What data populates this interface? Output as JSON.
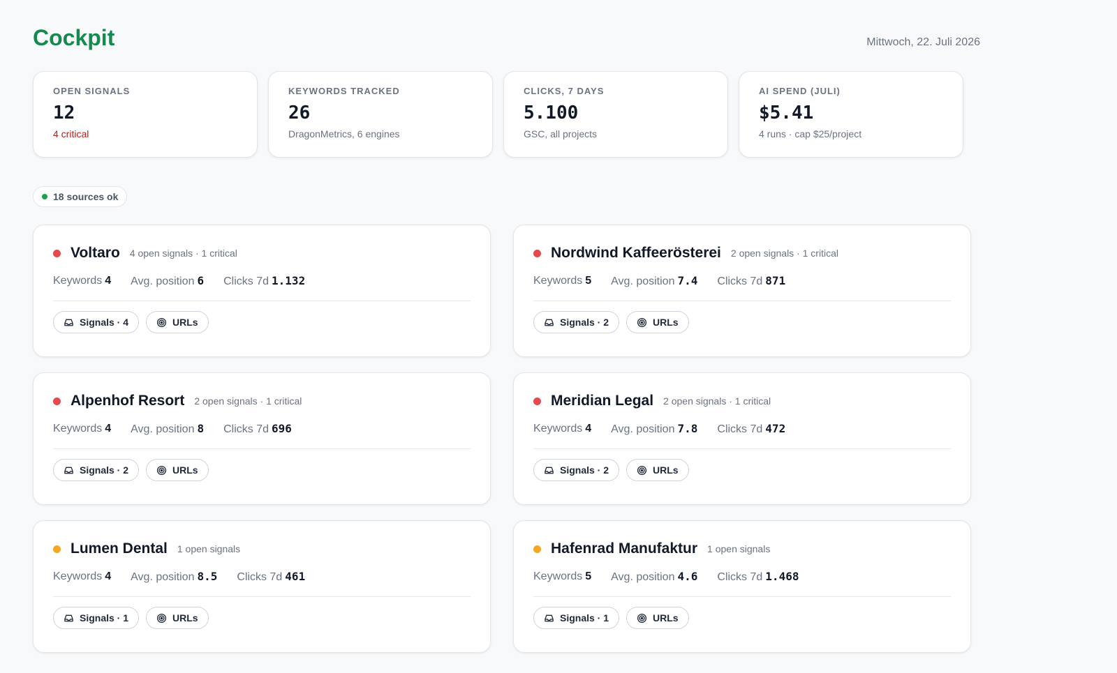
{
  "header": {
    "title": "Cockpit",
    "date": "Mittwoch, 22. Juli 2026"
  },
  "stats": [
    {
      "label": "Open signals",
      "value": "12",
      "sub": "4 critical",
      "sub_critical": true
    },
    {
      "label": "Keywords tracked",
      "value": "26",
      "sub": "DragonMetrics, 6 engines",
      "sub_critical": false
    },
    {
      "label": "Clicks, 7 days",
      "value": "5.100",
      "sub": "GSC, all projects",
      "sub_critical": false
    },
    {
      "label": "AI spend (Juli)",
      "value": "$5.41",
      "sub": "4 runs · cap $25/project",
      "sub_critical": false
    }
  ],
  "health": {
    "label": "18 sources ok",
    "color": "#16a34a"
  },
  "labels": {
    "keywords": "Keywords",
    "avg_position": "Avg. position",
    "clicks": "Clicks 7d",
    "urls": "URLs"
  },
  "colors": {
    "brand": "#15894f",
    "critical": "#e5484d",
    "warning": "#f5a623",
    "ok": "#16a34a"
  },
  "projects": [
    {
      "name": "Voltaro",
      "status": "critical",
      "status_color": "#e5484d",
      "meta": "4 open signals · 1 critical",
      "keywords": "4",
      "avg_position": "6",
      "clicks": "1.132",
      "signals_label": "Signals · 4",
      "icons": [
        "inbox-icon",
        "target-icon"
      ]
    },
    {
      "name": "Nordwind Kaffeerösterei",
      "status": "critical",
      "status_color": "#e5484d",
      "meta": "2 open signals · 1 critical",
      "keywords": "5",
      "avg_position": "7.4",
      "clicks": "871",
      "signals_label": "Signals · 2",
      "icons": [
        "inbox-icon",
        "target-icon"
      ]
    },
    {
      "name": "Alpenhof Resort",
      "status": "critical",
      "status_color": "#e5484d",
      "meta": "2 open signals · 1 critical",
      "keywords": "4",
      "avg_position": "8",
      "clicks": "696",
      "signals_label": "Signals · 2",
      "icons": [
        "inbox-icon",
        "target-icon"
      ]
    },
    {
      "name": "Meridian Legal",
      "status": "critical",
      "status_color": "#e5484d",
      "meta": "2 open signals · 1 critical",
      "keywords": "4",
      "avg_position": "7.8",
      "clicks": "472",
      "signals_label": "Signals · 2",
      "icons": [
        "inbox-icon",
        "target-icon"
      ]
    },
    {
      "name": "Lumen Dental",
      "status": "warning",
      "status_color": "#f5a623",
      "meta": "1 open signals",
      "keywords": "4",
      "avg_position": "8.5",
      "clicks": "461",
      "signals_label": "Signals · 1",
      "icons": [
        "inbox-icon",
        "target-icon"
      ]
    },
    {
      "name": "Hafenrad Manufaktur",
      "status": "warning",
      "status_color": "#f5a623",
      "meta": "1 open signals",
      "keywords": "5",
      "avg_position": "4.6",
      "clicks": "1.468",
      "signals_label": "Signals · 1",
      "icons": [
        "inbox-icon",
        "target-icon"
      ]
    }
  ]
}
